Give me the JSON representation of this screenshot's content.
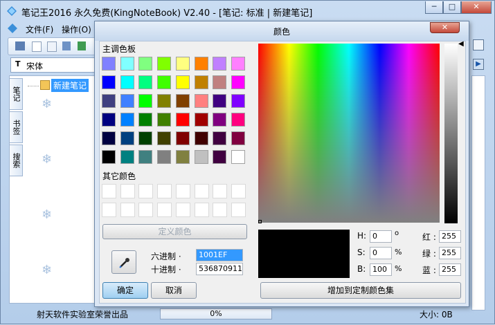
{
  "main": {
    "title": "笔记王2016 永久免费(KingNoteBook) V2.40 - [笔记: 标准 | 新建笔记]",
    "menu": [
      "文件(F)",
      "操作(O)"
    ],
    "font_name": "宋体",
    "tabs": [
      "笔记",
      "书签",
      "搜索"
    ],
    "tree_item": "新建笔记",
    "status_text": "射天软件实验室荣誉出品",
    "progress": "0%",
    "progress_value": 0,
    "size_text": "大小: 0B",
    "window_buttons": [
      "─",
      "□",
      "✕"
    ]
  },
  "dialog": {
    "title": "颜色",
    "close_glyph": "✕",
    "basic_colors_label": "主调色板",
    "custom_colors_label": "其它颜色",
    "define_button": "定义颜色",
    "hex_label": "六进制 ·",
    "hex_value": "1001EF",
    "dec_label": "十进制 ·",
    "dec_value": "536870911",
    "ok": "确定",
    "cancel": "取消",
    "add_custom": "增加到定制颜色集",
    "h_label": "H:",
    "h_value": "0",
    "h_unit": "o",
    "s_label": "S:",
    "s_value": "0",
    "s_unit": "%",
    "b_label": "B:",
    "b_value": "100",
    "b_unit": "%",
    "r_label": "红 :",
    "r_value": "255",
    "g_label": "绿 :",
    "g_value": "255",
    "bl_label": "蓝 :",
    "bl_value": "255",
    "basic_colors": [
      "#8080ff",
      "#80ffff",
      "#80ff80",
      "#80ff00",
      "#ffff80",
      "#ff8000",
      "#c080ff",
      "#ff80ff",
      "#0000ff",
      "#00ffff",
      "#00ff80",
      "#40ff00",
      "#ffff00",
      "#c08000",
      "#c08080",
      "#ff00ff",
      "#404080",
      "#4080ff",
      "#00ff00",
      "#808000",
      "#804000",
      "#ff8080",
      "#400080",
      "#8000ff",
      "#000080",
      "#0080ff",
      "#008000",
      "#408000",
      "#ff0000",
      "#a00000",
      "#800080",
      "#ff0080",
      "#000040",
      "#004080",
      "#004000",
      "#404000",
      "#800000",
      "#400000",
      "#400040",
      "#800040",
      "#000000",
      "#008080",
      "#408080",
      "#808080",
      "#808040",
      "#c0c0c0",
      "#400040",
      "#ffffff"
    ]
  }
}
